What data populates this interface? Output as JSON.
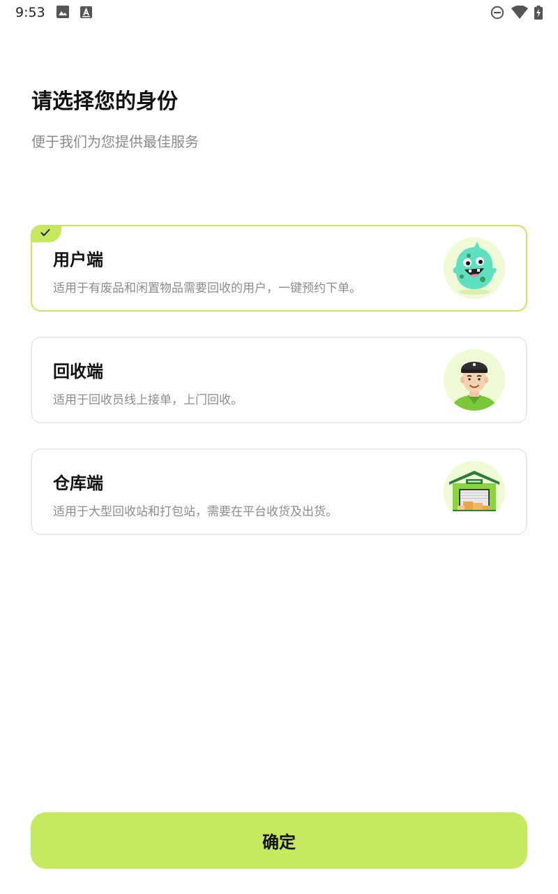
{
  "status_bar": {
    "time": "9:53",
    "icons": [
      "image-icon",
      "font-a-icon",
      "do-not-disturb-icon",
      "wifi-icon",
      "battery-charging-icon"
    ]
  },
  "header": {
    "title": "请选择您的身份",
    "subtitle": "便于我们为您提供最佳服务"
  },
  "options": [
    {
      "title": "用户端",
      "description": "适用于有废品和闲置物品需要回收的用户，一键预约下单。",
      "selected": true,
      "icon": "green-monster-mascot-icon"
    },
    {
      "title": "回收端",
      "description": "适用于回收员线上接单，上门回收。",
      "selected": false,
      "icon": "recycler-worker-avatar-icon"
    },
    {
      "title": "仓库端",
      "description": "适用于大型回收站和打包站，需要在平台收货及出货。",
      "selected": false,
      "icon": "warehouse-building-icon"
    }
  ],
  "confirm_label": "确定",
  "colors": {
    "accent": "#c6e960",
    "selected_border": "#c6e860",
    "card_border": "#ebebeb",
    "subtitle_text": "#8a8a8a"
  }
}
